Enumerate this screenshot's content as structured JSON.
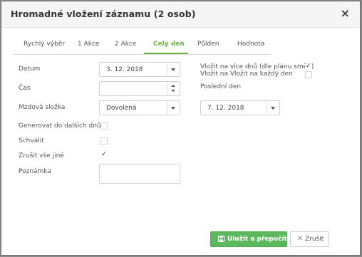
{
  "dialog": {
    "title": "Hromadné vložení záznamu (2 osob)",
    "close_glyph": "×"
  },
  "tabs": [
    {
      "label": "Rychlý výběr",
      "active": false
    },
    {
      "label": "1 Akce",
      "active": false
    },
    {
      "label": "2 Akce",
      "active": false
    },
    {
      "label": "Celý den",
      "active": true
    },
    {
      "label": "Půlden",
      "active": false
    },
    {
      "label": "Hodnota",
      "active": false
    }
  ],
  "form": {
    "date_label": "Datum",
    "date_value": "3. 12. 2018",
    "time_label": "Čas",
    "time_value": "",
    "payroll_label": "Mzdová složka",
    "payroll_value": "Dovolená",
    "generate_label": "Generovat do dalších dnů",
    "generate_checked": false,
    "approve_label": "Schválit",
    "approve_checked": false,
    "cancel_all_label": "Zrušit vše jiné",
    "cancel_all_checked": true,
    "note_label": "Poznámka",
    "note_value": ""
  },
  "right_options": {
    "multi_days_label": "Vložit na více dnů (dle plánu směn)",
    "multi_days_checked": true,
    "each_day_label": "Vložit na Vložit na každý den",
    "each_day_checked": false,
    "last_day_label": "Poslední den",
    "last_day_value": "7. 12. 2018"
  },
  "buttons": {
    "save_label": "Uložit a přepočítat",
    "cancel_label": "Zrušit",
    "cancel_glyph": "✕"
  },
  "colors": {
    "accent": "#6cb33f",
    "save_button": "#5cb85c"
  },
  "icons": {
    "check": "✓"
  }
}
